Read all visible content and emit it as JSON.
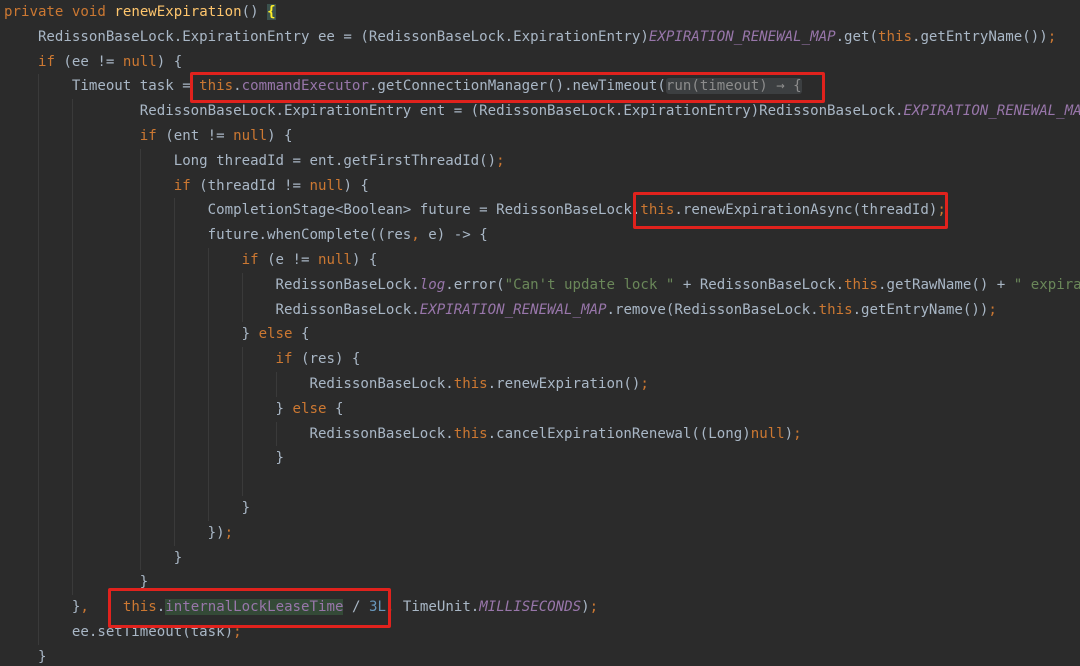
{
  "editor": {
    "language": "Java",
    "theme": {
      "background": "#2B2B2B",
      "text": "#A9B7C6",
      "keyword": "#CC7832",
      "method": "#FFC66D",
      "field": "#9876AA",
      "string": "#6A8759",
      "number": "#6897BB",
      "fold_text": "#8C8C8C",
      "fold_background": "#3C3F41",
      "usage_highlight": "#344A37",
      "brace_match": "#FFEF28",
      "annotation_box": "#E0221D"
    },
    "lines": [
      [
        [
          "private",
          "keyword"
        ],
        [
          " "
        ],
        [
          "void",
          "keyword"
        ],
        [
          " "
        ],
        [
          "renewExpiration",
          "method"
        ],
        [
          "() "
        ],
        [
          "{",
          "brace-match"
        ]
      ],
      [
        [
          "    RedissonBaseLock.ExpirationEntry ee = (RedissonBaseLock.ExpirationEntry)"
        ],
        [
          "EXPIRATION_RENEWAL_MAP",
          "constant"
        ],
        [
          ".get("
        ],
        [
          "this",
          "keyword"
        ],
        [
          ".getEntryName())"
        ],
        [
          ";",
          "keyword"
        ]
      ],
      [
        [
          "    "
        ],
        [
          "if",
          "keyword"
        ],
        [
          " (ee != "
        ],
        [
          "null",
          "keyword"
        ],
        [
          ") {"
        ]
      ],
      [
        [
          "        Timeout task = "
        ],
        [
          "this",
          "keyword"
        ],
        [
          "."
        ],
        [
          "commandExecutor",
          "field"
        ],
        [
          ".getConnectionManager().newTimeout("
        ],
        [
          "run(timeout) → {",
          "fold"
        ]
      ],
      [
        [
          "                RedissonBaseLock.ExpirationEntry ent = (RedissonBaseLock.ExpirationEntry)RedissonBaseLock."
        ],
        [
          "EXPIRATION_RENEWAL_MA",
          "constant"
        ]
      ],
      [
        [
          "                "
        ],
        [
          "if",
          "keyword"
        ],
        [
          " (ent != "
        ],
        [
          "null",
          "keyword"
        ],
        [
          ") {"
        ]
      ],
      [
        [
          "                    Long threadId = ent.getFirstThreadId()"
        ],
        [
          ";",
          "keyword"
        ]
      ],
      [
        [
          "                    "
        ],
        [
          "if",
          "keyword"
        ],
        [
          " (threadId != "
        ],
        [
          "null",
          "keyword"
        ],
        [
          ") {"
        ]
      ],
      [
        [
          "                        CompletionStage<Boolean> future = RedissonBaseLock."
        ],
        [
          "this",
          "keyword"
        ],
        [
          ".renewExpirationAsync(threadId)"
        ],
        [
          ";",
          "keyword"
        ]
      ],
      [
        [
          "                        future.whenComplete((res"
        ],
        [
          ",",
          "keyword"
        ],
        [
          " e) -> {"
        ]
      ],
      [
        [
          "                            "
        ],
        [
          "if",
          "keyword"
        ],
        [
          " (e != "
        ],
        [
          "null",
          "keyword"
        ],
        [
          ") {"
        ]
      ],
      [
        [
          "                                RedissonBaseLock."
        ],
        [
          "log",
          "constant"
        ],
        [
          ".error("
        ],
        [
          "\"Can't update lock \"",
          "string"
        ],
        [
          " + RedissonBaseLock."
        ],
        [
          "this",
          "keyword"
        ],
        [
          ".getRawName() + "
        ],
        [
          "\" expira",
          "string"
        ]
      ],
      [
        [
          "                                RedissonBaseLock."
        ],
        [
          "EXPIRATION_RENEWAL_MAP",
          "constant"
        ],
        [
          ".remove(RedissonBaseLock."
        ],
        [
          "this",
          "keyword"
        ],
        [
          ".getEntryName())"
        ],
        [
          ";",
          "keyword"
        ]
      ],
      [
        [
          "                            } "
        ],
        [
          "else",
          "keyword"
        ],
        [
          " {"
        ]
      ],
      [
        [
          "                                "
        ],
        [
          "if",
          "keyword"
        ],
        [
          " (res) {"
        ]
      ],
      [
        [
          "                                    RedissonBaseLock."
        ],
        [
          "this",
          "keyword"
        ],
        [
          ".renewExpiration()"
        ],
        [
          ";",
          "keyword"
        ]
      ],
      [
        [
          "                                } "
        ],
        [
          "else",
          "keyword"
        ],
        [
          " {"
        ]
      ],
      [
        [
          "                                    RedissonBaseLock."
        ],
        [
          "this",
          "keyword"
        ],
        [
          ".cancelExpirationRenewal((Long)"
        ],
        [
          "null",
          "keyword"
        ],
        [
          ")"
        ],
        [
          ";",
          "keyword"
        ]
      ],
      [
        [
          "                                }"
        ]
      ],
      [],
      [
        [
          "                            }"
        ]
      ],
      [
        [
          "                        })"
        ],
        [
          ";",
          "keyword"
        ]
      ],
      [
        [
          "                    }"
        ]
      ],
      [
        [
          "                }"
        ]
      ],
      [
        [
          "        }"
        ],
        [
          ",",
          "keyword"
        ],
        [
          "    "
        ],
        [
          "this",
          "keyword"
        ],
        [
          "."
        ],
        [
          "internalLockLeaseTime",
          "field-usage"
        ],
        [
          " / "
        ],
        [
          "3L",
          "number"
        ],
        [
          ",",
          "keyword"
        ],
        [
          " TimeUnit."
        ],
        [
          "MILLISECONDS",
          "constant"
        ],
        [
          ")"
        ],
        [
          ";",
          "keyword"
        ]
      ],
      [
        [
          "        ee.setTimeout(task)"
        ],
        [
          ";",
          "keyword"
        ]
      ],
      [
        [
          "    }"
        ]
      ]
    ]
  }
}
